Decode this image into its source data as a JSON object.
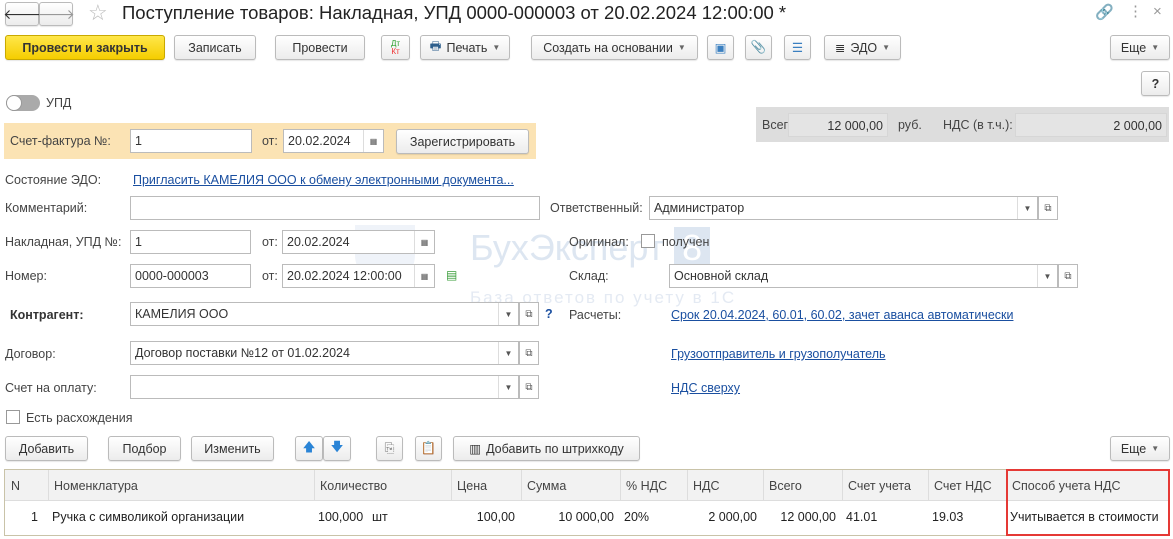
{
  "window": {
    "title": "Поступление товаров: Накладная, УПД 0000-000003 от 20.02.2024 12:00:00 *"
  },
  "toolbar": {
    "post_close": "Провести и закрыть",
    "save": "Записать",
    "post": "Провести",
    "dtkt_dt": "Дт",
    "dtkt_kt": "Кт",
    "print": "Печать",
    "create_based": "Создать на основании",
    "edo": "ЭДО",
    "more": "Еще",
    "help": "?"
  },
  "upd_toggle": {
    "label": "УПД",
    "on": false
  },
  "invoice": {
    "label": "Счет-фактура №:",
    "number": "1",
    "from_label": "от:",
    "date": "20.02.2024",
    "register": "Зарегистрировать"
  },
  "totals": {
    "total_label": "Всего:",
    "total": "12 000,00",
    "currency": "руб.",
    "vat_label": "НДС (в т.ч.):",
    "vat": "2 000,00"
  },
  "form": {
    "edo_state_label": "Состояние ЭДО:",
    "edo_state_link": "Пригласить КАМЕЛИЯ ООО к обмену электронными документа...",
    "comment_label": "Комментарий:",
    "comment": "",
    "responsible_label": "Ответственный:",
    "responsible": "Администратор",
    "waybill_label": "Накладная, УПД №:",
    "waybill": "1",
    "waybill_from": "от:",
    "waybill_date": "20.02.2024",
    "original_label": "Оригинал:",
    "original_received": "получен",
    "original_checked": false,
    "number_label": "Номер:",
    "number": "0000-000003",
    "number_from": "от:",
    "number_date": "20.02.2024 12:00:00",
    "warehouse_label": "Склад:",
    "warehouse": "Основной склад",
    "counterparty_label": "Контрагент:",
    "counterparty": "КАМЕЛИЯ ООО",
    "counterparty_help": "?",
    "settlements_label": "Расчеты:",
    "settlements_link": "Срок 20.04.2024, 60.01, 60.02, зачет аванса автоматически",
    "contract_label": "Договор:",
    "contract": "Договор поставки №12 от 01.02.2024",
    "shipper_link": "Грузоотправитель и грузополучатель",
    "payment_invoice_label": "Счет на оплату:",
    "payment_invoice": "",
    "vat_link": "НДС сверху",
    "discrepancies_label": "Есть расхождения",
    "discrepancies_checked": false
  },
  "watermark": {
    "brand": "БухЭксперт",
    "num": "8",
    "tagline": "База ответов по учету в 1С"
  },
  "table_toolbar": {
    "add": "Добавить",
    "select": "Подбор",
    "edit": "Изменить",
    "barcode": "Добавить по штрихкоду",
    "more": "Еще"
  },
  "table": {
    "headers": [
      "N",
      "Номенклатура",
      "Количество",
      "Цена",
      "Сумма",
      "% НДС",
      "НДС",
      "Всего",
      "Счет учета",
      "Счет НДС",
      "Способ учета НДС"
    ],
    "rows": [
      {
        "n": "1",
        "item": "Ручка с символикой организации",
        "qty": "100,000",
        "unit": "шт",
        "price": "100,00",
        "sum": "10 000,00",
        "vat_rate": "20%",
        "vat": "2 000,00",
        "total": "12 000,00",
        "account": "41.01",
        "vat_account": "19.03",
        "vat_method": "Учитывается в стоимости"
      }
    ]
  },
  "colors": {
    "highlight": "#e53935",
    "invoice_bg": "#fbe3b4",
    "primary": "#f5cd00",
    "link": "#1a4fa0"
  }
}
